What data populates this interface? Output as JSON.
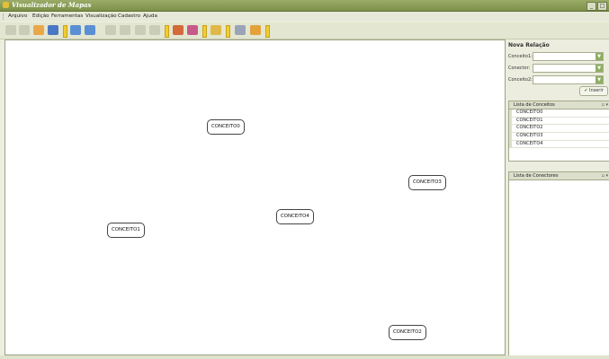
{
  "window": {
    "title": "Visualizador de Mapas",
    "minimize": "_",
    "maximize": "□"
  },
  "menu": [
    "Arquivo",
    "Edição",
    "Ferramentas",
    "Visualização",
    "Cadastro",
    "Ajuda"
  ],
  "toolbar": {
    "icons": [
      "new-icon",
      "open-icon",
      "folder-icon",
      "save-icon",
      "sep",
      "import-icon",
      "export-icon",
      "sep",
      "cut-icon",
      "copy-icon",
      "paste-icon",
      "delete-icon",
      "sep",
      "pencil-icon",
      "brush-icon",
      "sep",
      "screen-icon",
      "sep",
      "users-icon",
      "settings-icon",
      "sep"
    ]
  },
  "canvas": {
    "nodes": [
      "CONCEITO0",
      "CONCEITO1",
      "CONCEITO2",
      "CONCEITO3",
      "CONCEITO4"
    ]
  },
  "sidebar": {
    "title": "Nova Relação",
    "fields": [
      {
        "label": "Conceito1:",
        "value": ""
      },
      {
        "label": "Conector:",
        "value": ""
      },
      {
        "label": "Conceito2:",
        "value": ""
      }
    ],
    "insert_label": "Inserir",
    "concepts_header": "Lista de Conceitos",
    "concepts": [
      "CONCEITO0",
      "CONCEITO1",
      "CONCEITO2",
      "CONCEITO3",
      "CONCEITO4"
    ],
    "connectors_header": "Lista de Conectores",
    "connectors": []
  }
}
